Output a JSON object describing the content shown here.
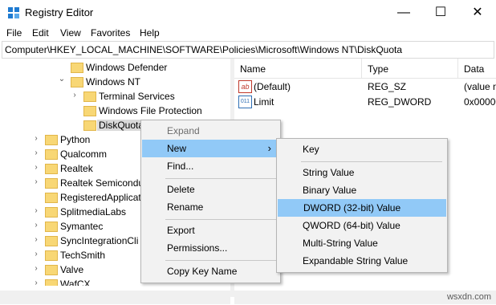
{
  "window": {
    "title": "Registry Editor",
    "controls": {
      "minimize": "—",
      "maximize": "☐",
      "close": "✕"
    }
  },
  "menubar": [
    "File",
    "Edit",
    "View",
    "Favorites",
    "Help"
  ],
  "address": {
    "path": "Computer\\HKEY_LOCAL_MACHINE\\SOFTWARE\\Policies\\Microsoft\\Windows NT\\DiskQuota"
  },
  "tree": {
    "items": [
      {
        "label": "Windows Defender",
        "arrow": ""
      },
      {
        "label": "Windows NT",
        "arrow": "⌄"
      },
      {
        "label": "Terminal Services",
        "arrow": "›"
      },
      {
        "label": "Windows File Protection",
        "arrow": ""
      },
      {
        "label": "DiskQuota",
        "arrow": ""
      },
      {
        "label": "Python",
        "arrow": "›"
      },
      {
        "label": "Qualcomm",
        "arrow": "›"
      },
      {
        "label": "Realtek",
        "arrow": "›"
      },
      {
        "label": "Realtek Semicondu",
        "arrow": "›"
      },
      {
        "label": "RegisteredApplicat",
        "arrow": ""
      },
      {
        "label": "SplitmediaLabs",
        "arrow": "›"
      },
      {
        "label": "Symantec",
        "arrow": "›"
      },
      {
        "label": "SyncIntegrationCli",
        "arrow": "›"
      },
      {
        "label": "TechSmith",
        "arrow": "›"
      },
      {
        "label": "Valve",
        "arrow": "›"
      },
      {
        "label": "WafCX",
        "arrow": "›"
      }
    ]
  },
  "list": {
    "columns": [
      "Name",
      "Type",
      "Data"
    ],
    "rows": [
      {
        "icon": "ab",
        "name": "(Default)",
        "type": "REG_SZ",
        "data": "(value n"
      },
      {
        "icon": "011",
        "name": "Limit",
        "type": "REG_DWORD",
        "data": "0x00000"
      }
    ]
  },
  "context_menu": {
    "items": [
      "Expand",
      "New",
      "Find...",
      "Delete",
      "Rename",
      "Export",
      "Permissions...",
      "Copy Key Name"
    ],
    "submenu_arrow": "›"
  },
  "submenu": {
    "items": [
      "Key",
      "String Value",
      "Binary Value",
      "DWORD (32-bit) Value",
      "QWORD (64-bit) Value",
      "Multi-String Value",
      "Expandable String Value"
    ]
  },
  "watermark": "wsxdn.com",
  "colors": {
    "highlight": "#91c9f7",
    "folder": "#f8d775",
    "selection": "#d9d9d9"
  }
}
